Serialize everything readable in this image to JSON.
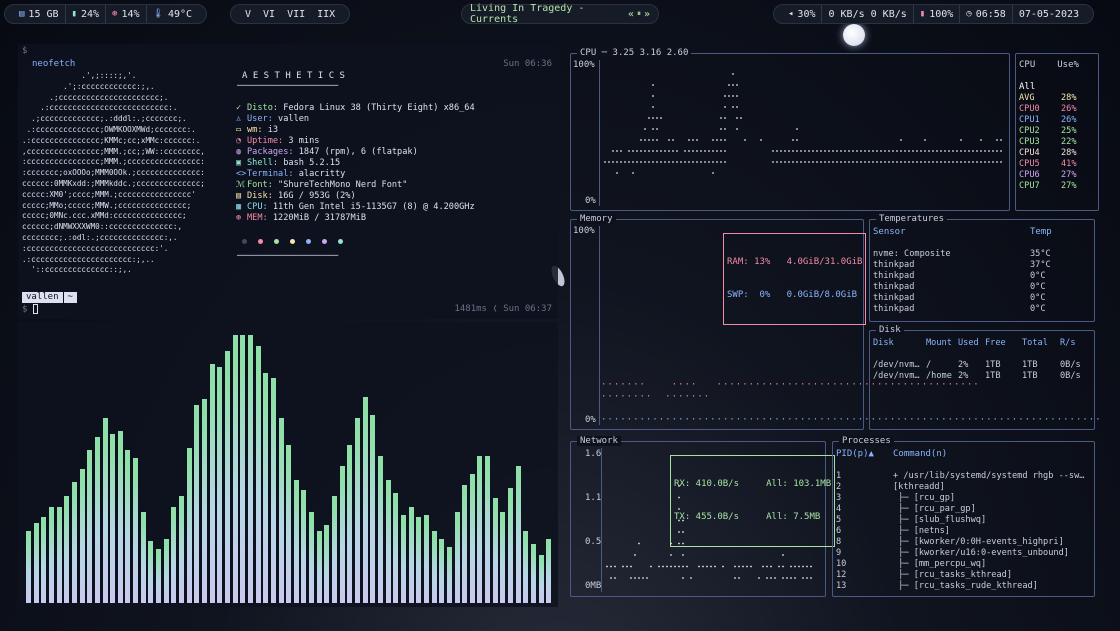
{
  "topbar": {
    "left": [
      {
        "icon": "database-icon",
        "value": "15 GB"
      },
      {
        "icon": "battery-icon",
        "value": "24%"
      },
      {
        "icon": "cpu-icon",
        "value": "14%"
      },
      {
        "icon": "thermometer-icon",
        "value": "49°C"
      }
    ],
    "workspaces": [
      "V",
      "VI",
      "VII",
      "IIX"
    ],
    "now_playing": "Living In Tragedy - Currents",
    "player_controls": [
      "«",
      "⏸",
      "»"
    ],
    "right": [
      {
        "icon": "volume-icon",
        "value": "30%"
      },
      {
        "icon": "network-icon",
        "value": "0 KB/s 0 KB/s"
      },
      {
        "icon": "battery-icon",
        "value": "100%"
      },
      {
        "icon": "clock-icon",
        "value": "06:58"
      },
      {
        "icon": "",
        "value": "07-05-2023"
      }
    ]
  },
  "terminal": {
    "prompt_top": "$",
    "command": "neofetch",
    "time_top": "Sun 06:36",
    "header": "A E S T H E T I C S",
    "divider": "─────────────────────",
    "info": [
      {
        "icon": "✓",
        "key": "Disto:",
        "value": " Fedora Linux 38 (Thirty Eight) x86_64",
        "color": "#a6e3a1"
      },
      {
        "icon": "♙",
        "key": "User:",
        "value": " vallen",
        "color": "#89b4fa"
      },
      {
        "icon": "▭",
        "key": "wm:",
        "value": " i3",
        "color": "#f9e2af"
      },
      {
        "icon": "◔",
        "key": "Uptime:",
        "value": " 3 mins",
        "color": "#f38ba8"
      },
      {
        "icon": "◍",
        "key": "Packages:",
        "value": " 1847 (rpm), 6 (flatpak)",
        "color": "#cba6f7"
      },
      {
        "icon": "▣",
        "key": "Shell:",
        "value": " bash 5.2.15",
        "color": "#94e2d5"
      },
      {
        "icon": "<>",
        "key": "Terminal:",
        "value": " alacritty",
        "color": "#89b4fa"
      },
      {
        "icon": "ℳ",
        "key": "Font:",
        "value": " \"ShureTechMono Nerd Font\"",
        "color": "#a6e3a1"
      },
      {
        "icon": "▤",
        "key": "Disk:",
        "value": " 16G / 953G (2%)",
        "color": "#f9e2af"
      },
      {
        "icon": "▦",
        "key": "CPU:",
        "value": " 11th Gen Intel i5-1135G7 (8) @ 4.200GHz",
        "color": "#89dceb"
      },
      {
        "icon": "⊛",
        "key": "MEM:",
        "value": " 1220MiB / 31787MiB",
        "color": "#f38ba8"
      }
    ],
    "ascii": "             .',;::::;,'.\n         .';:cccccccccccc:;,.\n      .;cccccccccccccccccccccc;.\n    .:cccccccccccccccccccccccccc:.\n  .;ccccccccccccc;.:dddl:.;ccccccc;.\n .:cccccccccccccc;OWMKOOXMWd;ccccccc:.\n.:ccccccccccccccc;KMMc;cc;xMMc:cccccc:.\n,cccccccccccccccc;MMM.;cc;;WW::cccccccc,\n:cccccccccccccccc;MMM.;cccccccccccccccc:\n:ccccccc;oxOOOo;MMM0OOk.;cccccccccccccc:\ncccccc:0MMKxdd:;MMMkddc.;cccccccccccccc;\nccccc:XM0';cccc;MMM.;cccccccccccccccc'\nccccc;MMo;ccccc;MMW.;ccccccccccccccc;\nccccc;0MNc.ccc.xMMd:ccccccccccccccc;\ncccccc;dNMWXXXWM0::cccccccccccccc:,\ncccccccc;.:odl:.;cccccccccccccc:,.\n:cccccccccccccccccccccccccccc:'.\n.:cccccccccccccccccccccc:;,..\n  '::cccccccccccccc::;,.",
    "palette": [
      "#45475a",
      "#f38ba8",
      "#a6e3a1",
      "#f9e2af",
      "#89b4fa",
      "#cba6f7",
      "#94e2d5"
    ],
    "prompt_user": "vallen",
    "prompt_dir": "~",
    "duration": "1481ms",
    "time_bottom": "Sun 06:37",
    "prompt_bottom": "$"
  },
  "visualizer": {
    "levels": [
      0.27,
      0.3,
      0.32,
      0.36,
      0.36,
      0.4,
      0.45,
      0.5,
      0.57,
      0.62,
      0.69,
      0.63,
      0.64,
      0.57,
      0.54,
      0.34,
      0.23,
      0.2,
      0.24,
      0.36,
      0.4,
      0.58,
      0.74,
      0.76,
      0.89,
      0.88,
      0.94,
      1.0,
      1.0,
      1.0,
      0.96,
      0.86,
      0.84,
      0.69,
      0.59,
      0.46,
      0.42,
      0.34,
      0.27,
      0.29,
      0.4,
      0.51,
      0.59,
      0.69,
      0.77,
      0.7,
      0.55,
      0.46,
      0.41,
      0.33,
      0.36,
      0.32,
      0.33,
      0.27,
      0.24,
      0.21,
      0.34,
      0.44,
      0.48,
      0.55,
      0.55,
      0.39,
      0.34,
      0.43,
      0.51,
      0.27,
      0.22,
      0.18,
      0.24
    ]
  },
  "btop": {
    "cpu": {
      "title": "CPU",
      "load": "3.25 3.16 2.60",
      "top_label": "100%",
      "bottom_label": "0%",
      "col_cpu": "CPU",
      "col_use": "Use%",
      "all_label": "All",
      "rows": [
        {
          "name": "AVG",
          "use": "28%",
          "color": "#f9e2af"
        },
        {
          "name": "CPU0",
          "use": "26%",
          "color": "#f38ba8"
        },
        {
          "name": "CPU1",
          "use": "26%",
          "color": "#89b4fa"
        },
        {
          "name": "CPU2",
          "use": "25%",
          "color": "#a6e3a1"
        },
        {
          "name": "CPU3",
          "use": "22%",
          "color": "#a6e3a1"
        },
        {
          "name": "CPU4",
          "use": "28%",
          "color": "#f5e0dc"
        },
        {
          "name": "CPU5",
          "use": "41%",
          "color": "#f38ba8"
        },
        {
          "name": "CPU6",
          "use": "27%",
          "color": "#cba6f7"
        },
        {
          "name": "CPU7",
          "use": "27%",
          "color": "#a6e3a1"
        }
      ]
    },
    "memory": {
      "title": "Memory",
      "top_label": "100%",
      "bottom_label": "0%",
      "ram": "RAM: 13%   4.0GiB/31.0GiB",
      "swp": "SWP:  0%   0.0GiB/8.0GiB"
    },
    "temps": {
      "title": "Temperatures",
      "col_sensor": "Sensor",
      "col_temp": "Temp",
      "rows": [
        {
          "sensor": "nvme: Composite",
          "temp": "35°C"
        },
        {
          "sensor": "thinkpad",
          "temp": "37°C"
        },
        {
          "sensor": "thinkpad",
          "temp": "0°C"
        },
        {
          "sensor": "thinkpad",
          "temp": "0°C"
        },
        {
          "sensor": "thinkpad",
          "temp": "0°C"
        },
        {
          "sensor": "thinkpad",
          "temp": "0°C"
        }
      ]
    },
    "disk": {
      "title": "Disk",
      "headers": [
        "Disk",
        "Mount",
        "Used",
        "Free",
        "Total",
        "R/s"
      ],
      "rows": [
        [
          "/dev/nvm…",
          "/",
          "2%",
          "1TB",
          "1TB",
          "0B/s"
        ],
        [
          "/dev/nvm…",
          "/home",
          "2%",
          "1TB",
          "1TB",
          "0B/s"
        ]
      ]
    },
    "network": {
      "title": "Network",
      "y_labels": [
        "1.6",
        "1.1",
        "0.5",
        "0MB"
      ],
      "rx": "RX: 410.0B/s     All: 103.1MB",
      "tx": "TX: 455.0B/s     All: 7.5MB"
    },
    "processes": {
      "title": "Processes",
      "col_pid": "PID(p)▲",
      "col_cmd": "Command(n)",
      "rows": [
        {
          "pid": "1",
          "cmd": "+ /usr/lib/systemd/systemd rhgb --sw…"
        },
        {
          "pid": "2",
          "cmd": "[kthreadd]"
        },
        {
          "pid": "3",
          "cmd": " ├─ [rcu_gp]"
        },
        {
          "pid": "4",
          "cmd": " ├─ [rcu_par_gp]"
        },
        {
          "pid": "5",
          "cmd": " ├─ [slub_flushwq]"
        },
        {
          "pid": "6",
          "cmd": " ├─ [netns]"
        },
        {
          "pid": "8",
          "cmd": " ├─ [kworker/0:0H-events_highpri]"
        },
        {
          "pid": "9",
          "cmd": " ├─ [kworker/u16:0-events_unbound]"
        },
        {
          "pid": "10",
          "cmd": " ├─ [mm_percpu_wq]"
        },
        {
          "pid": "12",
          "cmd": " ├─ [rcu_tasks_kthread]"
        },
        {
          "pid": "13",
          "cmd": " ├─ [rcu_tasks_rude_kthread]"
        }
      ]
    }
  }
}
